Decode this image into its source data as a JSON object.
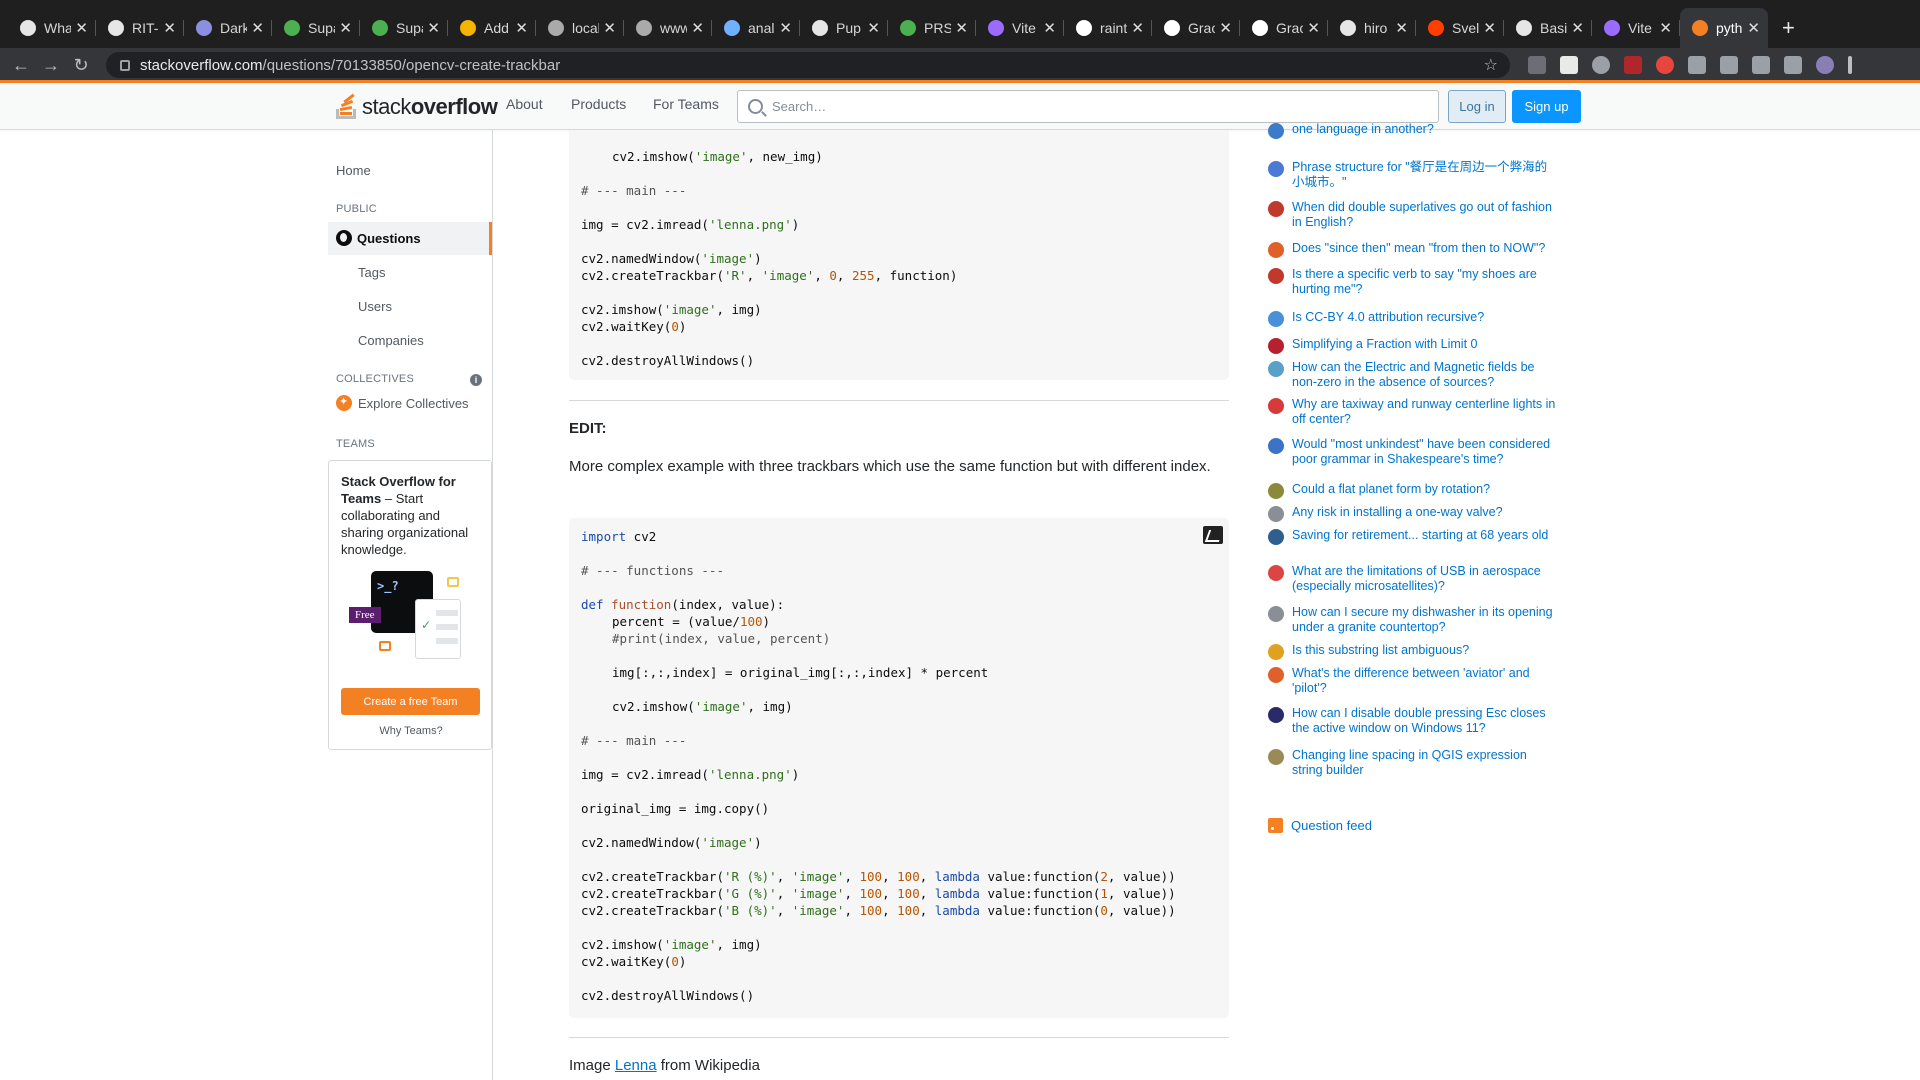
{
  "browser": {
    "tabs": [
      {
        "title": "What",
        "icon": "github-icon"
      },
      {
        "title": "RIT-",
        "icon": "github-icon"
      },
      {
        "title": "Dark",
        "icon": "moon-icon"
      },
      {
        "title": "Supa",
        "icon": "app-icon"
      },
      {
        "title": "Supa",
        "icon": "app-icon"
      },
      {
        "title": "Add",
        "icon": "hand-icon"
      },
      {
        "title": "local",
        "icon": "globe-icon"
      },
      {
        "title": "www",
        "icon": "globe-icon"
      },
      {
        "title": "anal",
        "icon": "infinity-icon"
      },
      {
        "title": "Pup",
        "icon": "github-icon"
      },
      {
        "title": "PRS",
        "icon": "app-icon"
      },
      {
        "title": "Vite",
        "icon": "vite-icon"
      },
      {
        "title": "raint",
        "icon": "google-icon"
      },
      {
        "title": "Grac",
        "icon": "google-icon"
      },
      {
        "title": "Grac",
        "icon": "google-icon"
      },
      {
        "title": "hiro",
        "icon": "github-icon"
      },
      {
        "title": "Svel",
        "icon": "svelte-icon"
      },
      {
        "title": "Basi",
        "icon": "github-icon"
      },
      {
        "title": "Vite",
        "icon": "vite-icon"
      },
      {
        "title": "pyth",
        "icon": "stackoverflow-icon"
      }
    ],
    "url_host": "stackoverflow.com",
    "url_path": "/questions/70133850/opencv-create-trackbar"
  },
  "header": {
    "logo_plain": "stack",
    "logo_bold": "overflow",
    "nav": [
      "About",
      "Products",
      "For Teams"
    ],
    "search_placeholder": "Search…",
    "login": "Log in",
    "signup": "Sign up"
  },
  "sidebar": {
    "home": "Home",
    "public_label": "PUBLIC",
    "questions": "Questions",
    "tags": "Tags",
    "users": "Users",
    "companies": "Companies",
    "collectives_label": "COLLECTIVES",
    "explore_collectives": "Explore Collectives",
    "teams_label": "TEAMS",
    "teams_card": {
      "title": "Stack Overflow for Teams",
      "dash": " – Start collaborating and sharing organizational knowledge.",
      "free_badge": "Free",
      "terminal": ">_?",
      "create_button": "Create a free Team",
      "why_link": "Why Teams?"
    }
  },
  "main": {
    "edit_heading": "EDIT:",
    "edit_text": "More complex example with three trackbars which use the same function but with different index.",
    "image_credit_prefix": "Image ",
    "image_credit_link": "Lenna",
    "image_credit_suffix": " from Wikipedia"
  },
  "hot_questions": [
    {
      "title": "one language in another?",
      "color": "#3b7bc8"
    },
    {
      "title": "Phrase structure for \"餐厅是在周边一个弊海的小城市。\"",
      "color": "#4a7ad6"
    },
    {
      "title": "When did double superlatives go out of fashion in English?",
      "color": "#c0392b"
    },
    {
      "title": "Does \"since then\" mean \"from then to NOW\"?",
      "color": "#e0602b"
    },
    {
      "title": "Is there a specific verb to say \"my shoes are hurting me\"?",
      "color": "#c0392b"
    },
    {
      "title": "Is CC-BY 4.0 attribution recursive?",
      "color": "#4a90d9"
    },
    {
      "title": "Simplifying a Fraction with Limit 0",
      "color": "#b7202e"
    },
    {
      "title": "How can the Electric and Magnetic fields be non-zero in the absence of sources?",
      "color": "#5aa0c8"
    },
    {
      "title": "Why are taxiway and runway centerline lights in off center?",
      "color": "#d63a3a"
    },
    {
      "title": "Would \"most unkindest\" have been considered poor grammar in Shakespeare's time?",
      "color": "#3b73c7"
    },
    {
      "title": "Could a flat planet form by rotation?",
      "color": "#8a8a3a"
    },
    {
      "title": "Any risk in installing a one-way valve?",
      "color": "#8a8f95"
    },
    {
      "title": "Saving for retirement... starting at 68 years old",
      "color": "#2e5f8f"
    },
    {
      "title": "What are the limitations of USB in aerospace (especially microsatellites)?",
      "color": "#d44"
    },
    {
      "title": "How can I secure my dishwasher in its opening under a granite countertop?",
      "color": "#8a8f95"
    },
    {
      "title": "Is this substring list ambiguous?",
      "color": "#e0a020"
    },
    {
      "title": "What's the difference between 'aviator' and 'pilot'?",
      "color": "#e0602b"
    },
    {
      "title": "How can I disable double pressing Esc closes the active window on Windows 11?",
      "color": "#2a2a6a"
    },
    {
      "title": "Changing line spacing in QGIS expression string builder",
      "color": "#9a8a5a"
    }
  ],
  "question_feed": "Question feed"
}
